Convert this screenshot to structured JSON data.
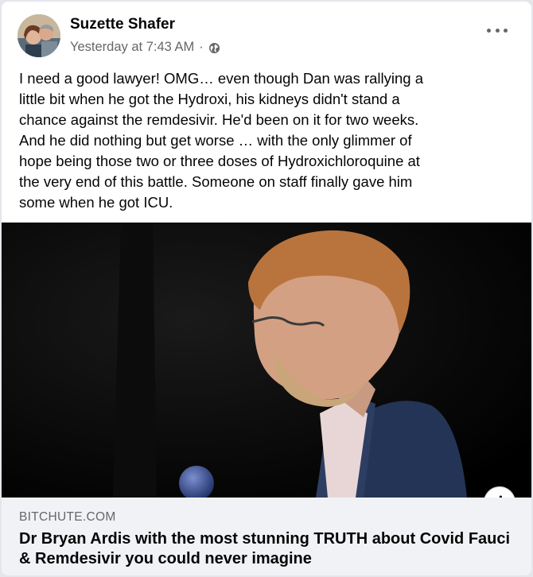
{
  "post": {
    "author": "Suzette Shafer",
    "timestamp": "Yesterday at 7:43 AM",
    "separator": "·",
    "privacy_icon": "globe-icon",
    "more_icon": "more-options-icon",
    "text": "I need a good lawyer!   OMG… even though Dan was rallying a\nlittle bit when he got the Hydroxi, his kidneys didn't stand a\nchance against the remdesivir.  He'd been on it for two weeks.\nAnd he did nothing but get worse … with the only glimmer of\nhope being those two or three doses of Hydroxichloroquine at\nthe very end of this battle.  Someone on staff finally gave him\nsome when he got ICU."
  },
  "link": {
    "domain": "BITCHUTE.COM",
    "title": "Dr Bryan Ardis with the most stunning TRUTH about Covid Fauci & Remdesivir you could never imagine",
    "info_icon": "info-icon",
    "info_glyph": "i"
  },
  "colors": {
    "primary_text": "#050505",
    "secondary_text": "#65676b",
    "preview_bg": "#f0f2f5"
  }
}
